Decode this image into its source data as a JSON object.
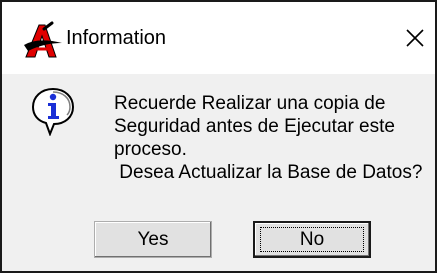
{
  "window": {
    "title": "Information",
    "app_icon": "app-a-logo-icon",
    "close_icon": "close-icon"
  },
  "dialog": {
    "icon": "information-icon",
    "message_lines": [
      "Recuerde Realizar una copia de",
      "Seguridad antes de Ejecutar este",
      "proceso.",
      " Desea Actualizar la Base de Datos?"
    ]
  },
  "buttons": {
    "yes_label": "Yes",
    "no_label": "No",
    "default": "No"
  },
  "colors": {
    "titlebar": "#ffffff",
    "body": "#f0f0f0",
    "button": "#e1e1e1",
    "info_icon": "#1a2fd6",
    "app_icon_red": "#e00000"
  }
}
